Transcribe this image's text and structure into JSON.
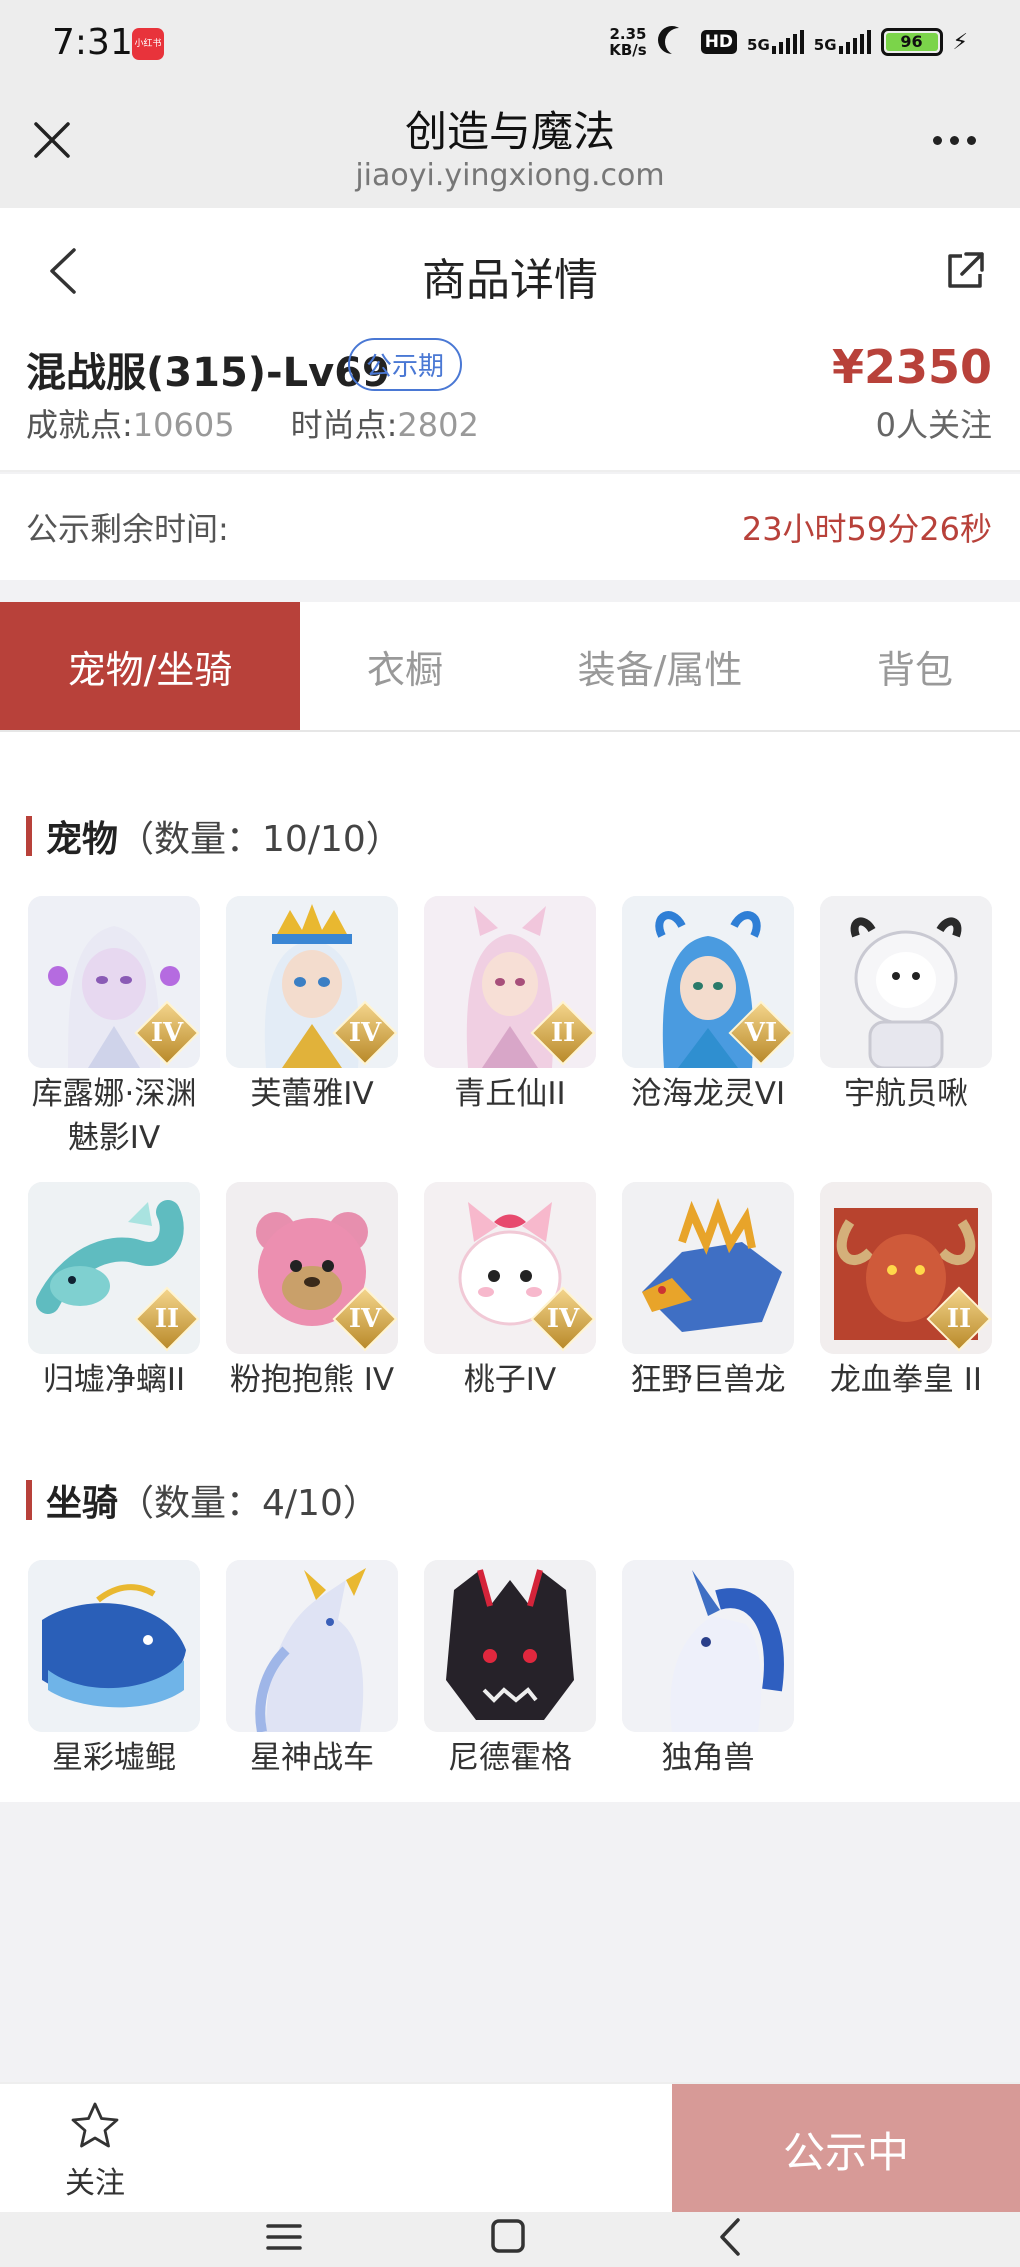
{
  "status_bar": {
    "time": "7:31",
    "app_badge": "小红书",
    "net_speed_value": "2.35",
    "net_speed_unit": "KB/s",
    "hd": "HD",
    "sim1": "5G",
    "sim2": "5G",
    "battery": "96"
  },
  "browser": {
    "title": "创造与魔法",
    "url": "jiaoyi.yingxiong.com"
  },
  "header": {
    "title": "商品详情"
  },
  "product": {
    "name": "混战服(315)-Lv69",
    "badge": "公示期",
    "price": "¥2350",
    "achievement_label": "成就点:",
    "achievement_value": "10605",
    "fashion_label": "时尚点:",
    "fashion_value": "2802",
    "followers": "0人关注"
  },
  "countdown": {
    "label": "公示剩余时间:",
    "value": "23小时59分26秒"
  },
  "tabs": [
    "宠物/坐骑",
    "衣橱",
    "装备/属性",
    "背包"
  ],
  "pets": {
    "title": "宠物",
    "count": "（数量：10/10）",
    "items": [
      {
        "name": "库露娜·深渊魅影IV",
        "rank": "IV",
        "icon": "pet-kuluna-icon"
      },
      {
        "name": "芙蕾雅IV",
        "rank": "IV",
        "icon": "pet-freya-icon"
      },
      {
        "name": "青丘仙II",
        "rank": "II",
        "icon": "pet-qingqiu-icon"
      },
      {
        "name": "沧海龙灵VI",
        "rank": "VI",
        "icon": "pet-canghai-icon"
      },
      {
        "name": "宇航员啾",
        "rank": "",
        "icon": "pet-astronaut-icon"
      },
      {
        "name": "归墟净螭II",
        "rank": "II",
        "icon": "pet-guixu-icon"
      },
      {
        "name": "粉抱抱熊 IV",
        "rank": "IV",
        "icon": "pet-bear-icon"
      },
      {
        "name": "桃子IV",
        "rank": "IV",
        "icon": "pet-taozi-icon"
      },
      {
        "name": "狂野巨兽龙",
        "rank": "",
        "icon": "pet-wild-dragon-icon"
      },
      {
        "name": "龙血拳皇 II",
        "rank": "II",
        "icon": "pet-dragonblood-icon"
      }
    ]
  },
  "mounts": {
    "title": "坐骑",
    "count": "（数量：4/10）",
    "items": [
      {
        "name": "星彩墟鲲",
        "icon": "mount-whale-icon"
      },
      {
        "name": "星神战车",
        "icon": "mount-chariot-icon"
      },
      {
        "name": "尼德霍格",
        "icon": "mount-nidhogg-icon"
      },
      {
        "name": "独角兽",
        "icon": "mount-unicorn-icon"
      }
    ]
  },
  "bottom": {
    "follow_label": "关注",
    "status_label": "公示中"
  },
  "colors": {
    "accent": "#b8413a",
    "badge_blue": "#4a78d4",
    "status_button": "#d79a97"
  }
}
